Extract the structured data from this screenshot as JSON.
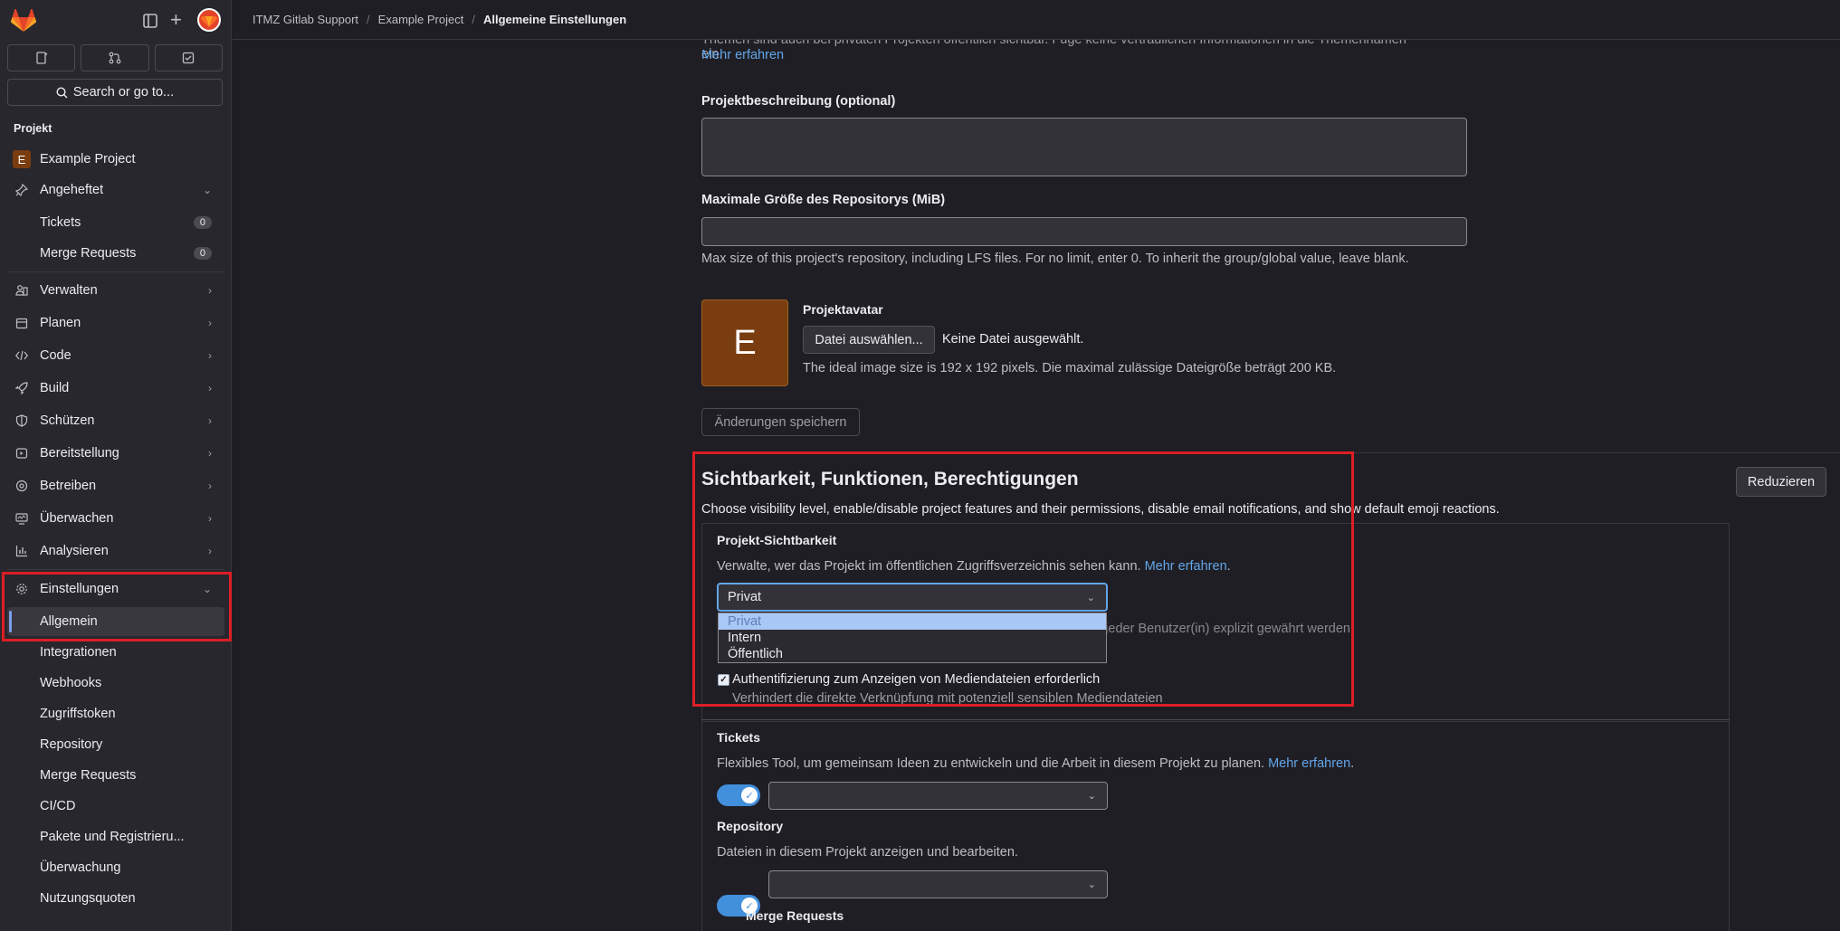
{
  "breadcrumb": [
    "ITMZ Gitlab Support",
    "Example Project",
    "Allgemeine Einstellungen"
  ],
  "sidebar": {
    "search_label": "Search or go to...",
    "section_title": "Projekt",
    "project_name": "Example Project",
    "project_initial": "E",
    "pinned_label": "Angeheftet",
    "pinned_items": [
      {
        "label": "Tickets",
        "count": "0"
      },
      {
        "label": "Merge Requests",
        "count": "0"
      }
    ],
    "menu": [
      {
        "label": "Verwalten",
        "icon": "users-icon"
      },
      {
        "label": "Planen",
        "icon": "calendar-icon"
      },
      {
        "label": "Code",
        "icon": "code-icon"
      },
      {
        "label": "Build",
        "icon": "rocket-icon"
      },
      {
        "label": "Schützen",
        "icon": "shield-icon"
      },
      {
        "label": "Bereitstellung",
        "icon": "deployments-icon"
      },
      {
        "label": "Betreiben",
        "icon": "cloud-icon"
      },
      {
        "label": "Überwachen",
        "icon": "monitor-icon"
      },
      {
        "label": "Analysieren",
        "icon": "chart-icon"
      }
    ],
    "settings_label": "Einstellungen",
    "settings_items": [
      "Allgemein",
      "Integrationen",
      "Webhooks",
      "Zugriffstoken",
      "Repository",
      "Merge Requests",
      "CI/CD",
      "Pakete und Registrieru...",
      "Überwachung",
      "Nutzungsquoten"
    ]
  },
  "form": {
    "topics_help": "Themen sind auch bei privaten Projekten öffentlich sichtbar. Füge keine vertraulichen Informationen in die Themennamen ein.",
    "topics_link": "Mehr erfahren",
    "description_label": "Projektbeschreibung (optional)",
    "repo_size_label": "Maximale Größe des Repositorys (MiB)",
    "repo_size_help": "Max size of this project's repository, including LFS files. For no limit, enter 0. To inherit the group/global value, leave blank.",
    "avatar_initial": "E",
    "avatar_label": "Projektavatar",
    "choose_file_button": "Datei auswählen...",
    "no_file_text": "Keine Datei ausgewählt.",
    "avatar_help": "The ideal image size is 192 x 192 pixels. Die maximal zulässige Dateigröße beträgt 200 KB.",
    "save_button": "Änderungen speichern"
  },
  "visibility": {
    "title": "Sichtbarkeit, Funktionen, Berechtigungen",
    "collapse_button": "Reduzieren",
    "description": "Choose visibility level, enable/disable project features and their permissions, disable email notifications, and show default emoji reactions.",
    "project_visibility_label": "Projekt-Sichtbarkeit",
    "project_visibility_help": "Verwalte, wer das Projekt im öffentlichen Zugriffsverzeichnis sehen kann.",
    "project_visibility_link": "Mehr erfahren",
    "selected": "Privat",
    "options": [
      "Privat",
      "Intern",
      "Öffentlich"
    ],
    "hidden_help_tail": "em/jeder Benutzer(in) explizit gewährt werden.",
    "auth_media_label": "Authentifizierung zum Anzeigen von Mediendateien erforderlich",
    "auth_media_help": "Verhindert die direkte Verknüpfung mit potenziell sensiblen Mediendateien",
    "tickets_label": "Tickets",
    "tickets_help": "Flexibles Tool, um gemeinsam Ideen zu entwickeln und die Arbeit in diesem Projekt zu planen.",
    "tickets_link": "Mehr erfahren",
    "repository_label": "Repository",
    "repository_help": "Dateien in diesem Projekt anzeigen und bearbeiten.",
    "merge_requests_label": "Merge Requests"
  }
}
